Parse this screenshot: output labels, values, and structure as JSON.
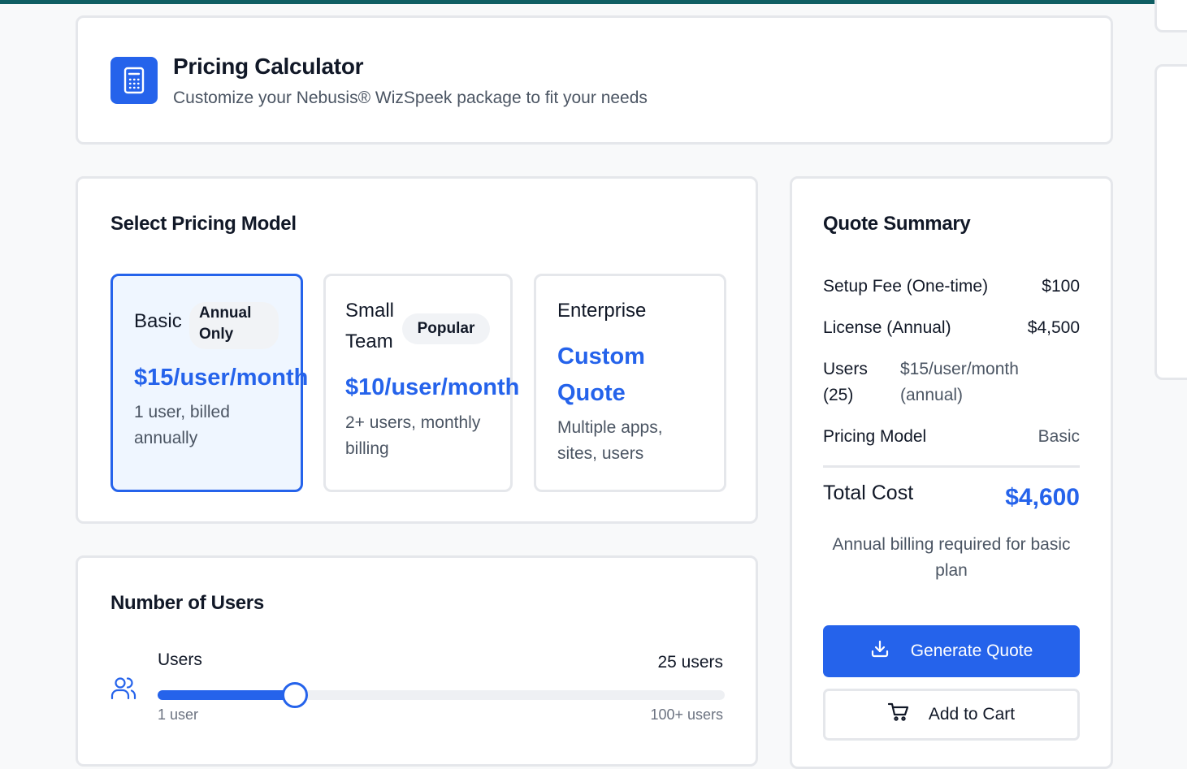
{
  "header": {
    "title": "Pricing Calculator",
    "subtitle": "Customize your Nebusis® WizSpeek package to fit your needs",
    "icon": "calculator-icon"
  },
  "pricing_model": {
    "section_title": "Select Pricing Model",
    "plans": [
      {
        "name": "Basic",
        "badge_line1": "Annual",
        "badge_line2": "Only",
        "price": "$15/user/month",
        "desc_line1": "1 user, billed",
        "desc_line2": "annually",
        "selected": true
      },
      {
        "name_line1": "Small",
        "name_line2": "Team",
        "badge": "Popular",
        "price": "$10/user/month",
        "desc_line1": "2+ users, monthly",
        "desc_line2": "billing",
        "selected": false
      },
      {
        "name": "Enterprise",
        "price_line1": "Custom",
        "price_line2": "Quote",
        "desc_line1": "Multiple apps,",
        "desc_line2": "sites, users",
        "selected": false
      }
    ]
  },
  "users": {
    "section_title": "Number of Users",
    "label": "Users",
    "value_text": "25 users",
    "value": 25,
    "min_label": "1 user",
    "max_label": "100+ users",
    "min": 1,
    "max": 100,
    "icon": "users-icon"
  },
  "summary": {
    "title": "Quote Summary",
    "setup_label": "Setup Fee (One-time)",
    "setup_value": "$100",
    "license_label": "License (Annual)",
    "license_value": "$4,500",
    "users_label_line1": "Users",
    "users_label_line2": "(25)",
    "users_value_line1": "$15/user/month",
    "users_value_line2": "(annual)",
    "model_label": "Pricing Model",
    "model_value": "Basic",
    "total_label": "Total Cost",
    "total_value": "$4,600",
    "note_line1": "Annual billing required for basic",
    "note_line2": "plan",
    "generate_label": "Generate Quote",
    "cart_label": "Add to Cart",
    "generate_icon": "download-icon",
    "cart_icon": "cart-icon"
  },
  "colors": {
    "accent": "#2563eb",
    "topbar": "#0f5e63",
    "selected_bg": "#eff6ff"
  }
}
